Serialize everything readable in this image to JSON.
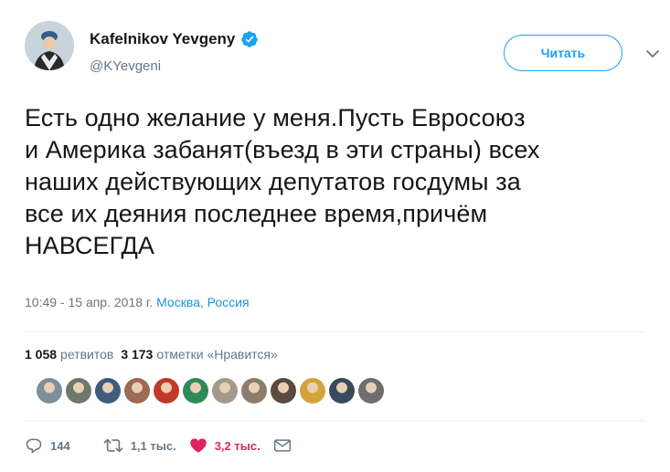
{
  "header": {
    "display_name": "Kafelnikov Yevgeny",
    "handle": "@KYevgeni",
    "follow_label": "Читать",
    "verified_icon": "verified-badge-icon",
    "caret_icon": "chevron-down-icon"
  },
  "tweet": {
    "text": "Есть одно желание у меня.Пусть Евросоюз\nи Америка забанят(въезд в эти страны) всех\nнаших действующих депутатов госдумы за\nвсе их деяния последнее время,причём\nНАВСЕГДА",
    "timestamp": "10:49 - 15 апр. 2018 г.",
    "location": "Москва, Россия"
  },
  "stats": {
    "retweets_count": "1 058",
    "retweets_label": "ретвитов",
    "likes_count": "3 173",
    "likes_label": "отметки «Нравится»"
  },
  "liker_avatars": [
    "#7d8f9c",
    "#6b7a6a",
    "#3f5c7a",
    "#9c6b54",
    "#c0392b",
    "#2e8b57",
    "#a39a8d",
    "#8b7d6b",
    "#5b4a3f",
    "#d4a33a",
    "#3a4a5a",
    "#6e6e6e"
  ],
  "actions": {
    "reply_count": "144",
    "retweet_count": "1,1 тыс.",
    "like_count": "3,2 тыс.",
    "reply_icon": "reply-icon",
    "retweet_icon": "retweet-icon",
    "like_icon": "heart-icon",
    "dm_icon": "envelope-icon"
  },
  "colors": {
    "accent": "#1da1f2",
    "link": "#1b95e0",
    "like": "#e0245e",
    "muted": "#657786",
    "text": "#14171a"
  }
}
